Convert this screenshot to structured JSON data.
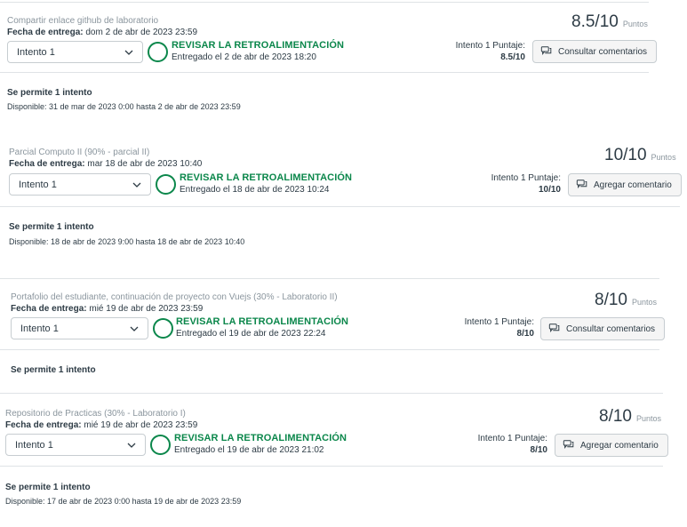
{
  "colors": {
    "accent_green": "#0b874b",
    "text": "#2d3b45",
    "muted": "#8b969e",
    "border": "#dfe3e6"
  },
  "assignments": [
    {
      "name": "Compartir enlace github de laboratorio",
      "due_label": "Fecha de entrega:",
      "due_value": "dom 2 de abr de 2023 23:59",
      "score": "8.5/10",
      "points_unit": "Puntos",
      "attempt_select": "Intento 1",
      "feedback_title": "REVISAR LA RETROALIMENTACIÓN",
      "submitted": "Entregado el 2 de abr de 2023 18:20",
      "attempt_score_label": "Intento 1 Puntaje:",
      "attempt_score_value": "8.5/10",
      "comment_button": "Consultar comentarios",
      "allowed": "Se permite 1 intento",
      "available": "Disponible: 31 de mar de 2023 0:00 hasta 2 de abr de 2023 23:59"
    },
    {
      "name": "Parcial Computo II (90% - parcial II)",
      "due_label": "Fecha de entrega:",
      "due_value": "mar 18 de abr de 2023 10:40",
      "score": "10/10",
      "points_unit": "Puntos",
      "attempt_select": "Intento 1",
      "feedback_title": "REVISAR LA RETROALIMENTACIÓN",
      "submitted": "Entregado el 18 de abr de 2023 10:24",
      "attempt_score_label": "Intento 1 Puntaje:",
      "attempt_score_value": "10/10",
      "comment_button": "Agregar comentario",
      "allowed": "Se permite 1 intento",
      "available": "Disponible: 18 de abr de 2023 9:00 hasta 18 de abr de 2023 10:40"
    },
    {
      "name": "Portafolio del estudiante, continuación de proyecto con Vuejs (30% - Laboratorio II)",
      "due_label": "Fecha de entrega:",
      "due_value": "mié 19 de abr de 2023 23:59",
      "score": "8/10",
      "points_unit": "Puntos",
      "attempt_select": "Intento 1",
      "feedback_title": "REVISAR LA RETROALIMENTACIÓN",
      "submitted": "Entregado el 19 de abr de 2023 22:24",
      "attempt_score_label": "Intento 1 Puntaje:",
      "attempt_score_value": "8/10",
      "comment_button": "Consultar comentarios",
      "allowed": "Se permite 1 intento",
      "available": ""
    },
    {
      "name": "Repositorio de Practicas (30% - Laboratorio I)",
      "due_label": "Fecha de entrega:",
      "due_value": "mié 19 de abr de 2023 23:59",
      "score": "8/10",
      "points_unit": "Puntos",
      "attempt_select": "Intento 1",
      "feedback_title": "REVISAR LA RETROALIMENTACIÓN",
      "submitted": "Entregado el 19 de abr de 2023 21:02",
      "attempt_score_label": "Intento 1 Puntaje:",
      "attempt_score_value": "8/10",
      "comment_button": "Agregar comentario",
      "allowed": "Se permite 1 intento",
      "available": "Disponible: 17 de abr de 2023 0:00 hasta 19 de abr de 2023 23:59"
    }
  ]
}
